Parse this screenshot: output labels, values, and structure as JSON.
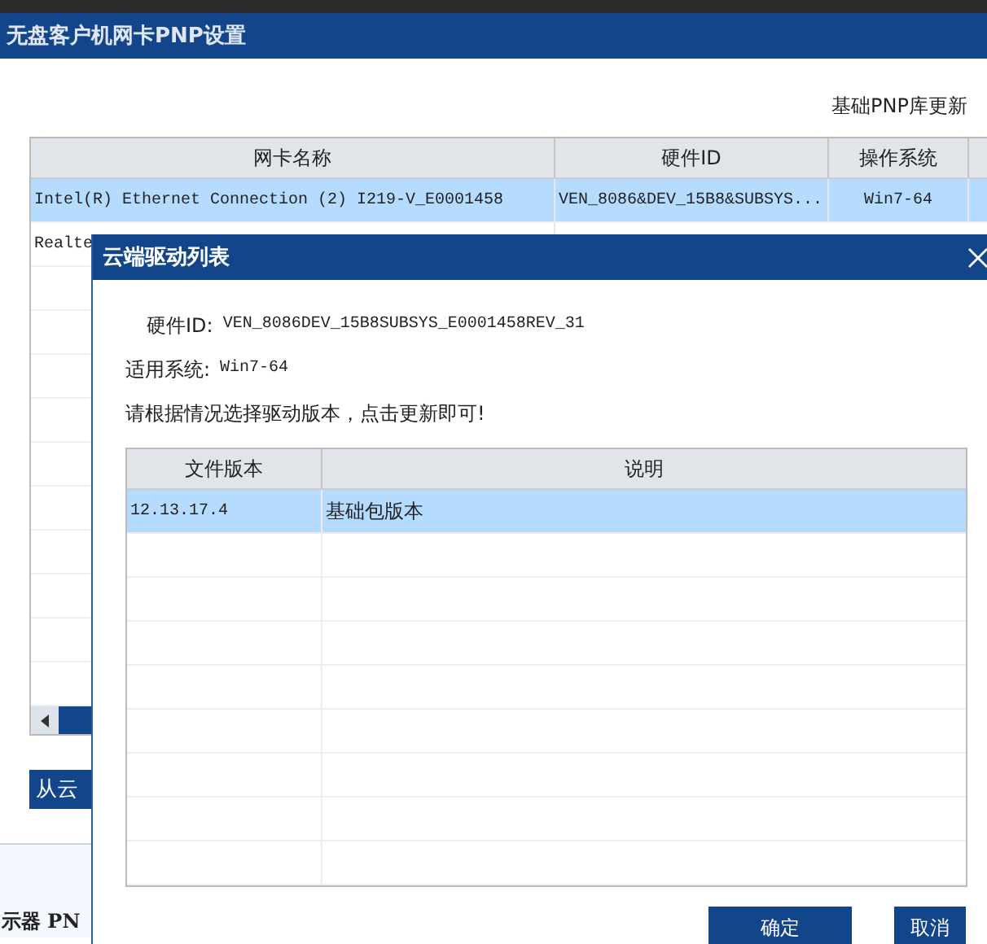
{
  "window": {
    "title": "无盘客户机网卡PNP设置"
  },
  "update_note": "基础PNP库更新",
  "adapter_table": {
    "columns": [
      "网卡名称",
      "硬件ID",
      "操作系统"
    ],
    "rows": [
      {
        "cells": [
          "Intel(R) Ethernet Connection (2) I219-V_E0001458",
          "VEN_8086&DEV_15B8&SUBSYS...",
          "Win7-64"
        ],
        "selected": true
      },
      {
        "cells": [
          "Realte"
        ],
        "selected": false
      }
    ]
  },
  "cloud_button": "从云",
  "section_label": "示器 PN",
  "dialog": {
    "title": "云端驱动列表",
    "fields": [
      {
        "label": "硬件ID:",
        "value": "VEN_8086DEV_15B8SUBSYS_E0001458REV_31"
      },
      {
        "label": "适用系统:",
        "value": "Win7-64"
      }
    ],
    "instruction": "请根据情况选择驱动版本，点击更新即可!",
    "table": {
      "columns": [
        "文件版本",
        "说明"
      ],
      "rows": [
        {
          "cells": [
            "12.13.17.4",
            "基础包版本"
          ],
          "selected": true
        }
      ]
    },
    "buttons": [
      {
        "label": "确定"
      },
      {
        "label": "取消"
      }
    ]
  }
}
